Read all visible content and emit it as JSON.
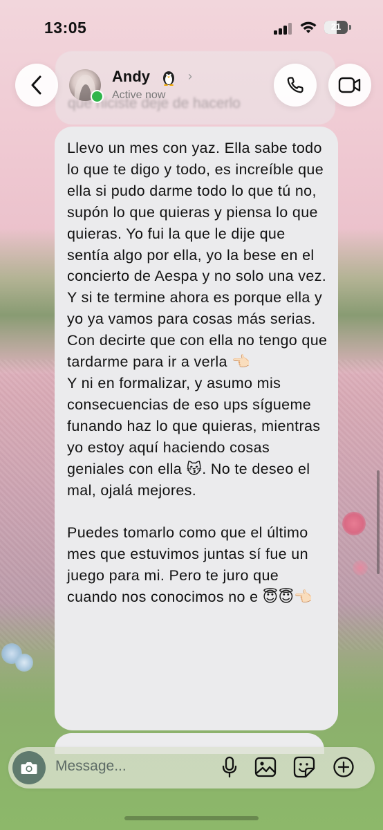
{
  "status_bar": {
    "time": "13:05",
    "battery": "21"
  },
  "header": {
    "contact_name": "Andy",
    "status": "Active now",
    "icons": [
      "back-arrow-icon",
      "phone-icon",
      "video-camera-icon",
      "penguin-emoji-icon",
      "chevron-right-icon"
    ]
  },
  "previous_message": {
    "preview_text": "que hiciste deje de hacerlo"
  },
  "message": {
    "text": "Llevo un mes con yaz. Ella sabe todo lo que te digo y todo, es increíble que ella si pudo darme todo lo que tú no, supón lo que quieras y piensa lo que quieras. Yo fui la que le dije que sentía algo por ella, yo la bese en el concierto de Aespa y no solo una vez. Y si te termine ahora es porque ella y yo ya vamos para cosas más serias. Con decirte que con ella no tengo que tardarme para ir a verla 👈🏻\nY ni en formalizar, y asumo mis consecuencias de eso ups sígueme funando haz lo que quieras, mientras yo estoy aquí haciendo cosas geniales con ella 😽. No te deseo el mal, ojalá mejores.\n\nPuedes tomarlo como que el último mes que estuvimos juntas sí fue un juego para mi. Pero te juro que cuando nos conocimos no e 😇😇👈🏻"
  },
  "composer": {
    "placeholder": "Message...",
    "icons": [
      "camera-icon",
      "microphone-icon",
      "gallery-icon",
      "sticker-icon",
      "plus-icon"
    ]
  },
  "colors": {
    "bubble": "#ebebed",
    "online": "#2fb54b",
    "camera_button": "#5f7a6e"
  }
}
